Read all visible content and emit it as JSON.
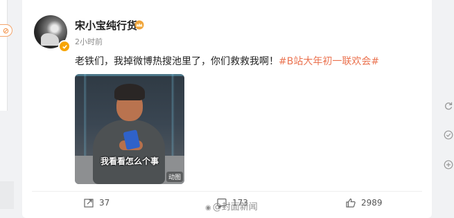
{
  "left_panel": {
    "pill_glyph": "⊘"
  },
  "post": {
    "username": "宋小宝纯行货",
    "time": "2小时前",
    "text_main": "老铁们，我掉微博热搜池里了，你们救救我啊！",
    "hashtag": "#B站大年初一联欢会#",
    "image": {
      "caption": "我看看怎么个事",
      "gif_label": "动图"
    }
  },
  "actions": {
    "repost_count": "37",
    "comment_count": "173",
    "like_count": "2989"
  },
  "watermark": {
    "text": "封面新闻",
    "prefix": "@"
  },
  "colors": {
    "accent": "#eb7350",
    "badge": "#f7a400",
    "crown": "#f0a43a"
  },
  "icons": [
    "crown-icon",
    "verified-badge-icon",
    "repost-icon",
    "comment-icon",
    "like-icon",
    "weibo-watermark-icon",
    "refresh-icon",
    "check-icon",
    "plus-icon"
  ]
}
